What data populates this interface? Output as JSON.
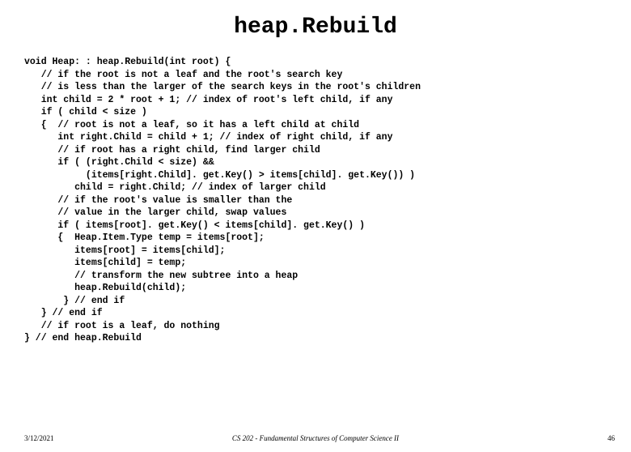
{
  "title": "heap.Rebuild",
  "code": "void Heap: : heap.Rebuild(int root) {\n   // if the root is not a leaf and the root's search key\n   // is less than the larger of the search keys in the root's children\n   int child = 2 * root + 1; // index of root's left child, if any\n   if ( child < size )\n   {  // root is not a leaf, so it has a left child at child\n      int right.Child = child + 1; // index of right child, if any\n      // if root has a right child, find larger child\n      if ( (right.Child < size) &&\n           (items[right.Child]. get.Key() > items[child]. get.Key()) )\n         child = right.Child; // index of larger child\n      // if the root's value is smaller than the\n      // value in the larger child, swap values\n      if ( items[root]. get.Key() < items[child]. get.Key() )\n      {  Heap.Item.Type temp = items[root];\n         items[root] = items[child];\n         items[child] = temp;\n         // transform the new subtree into a heap\n         heap.Rebuild(child);\n       } // end if\n   } // end if\n   // if root is a leaf, do nothing\n} // end heap.Rebuild",
  "footer": {
    "date": "3/12/2021",
    "course": "CS 202 - Fundamental Structures of Computer Science II",
    "page": "46"
  }
}
